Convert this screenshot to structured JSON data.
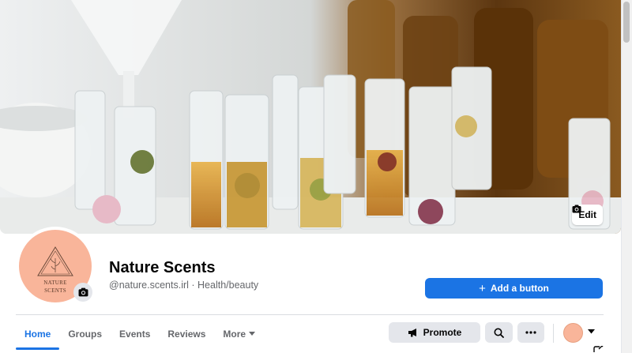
{
  "cover": {
    "edit_label": "Edit",
    "colors": {
      "bottle_amber": "#7a4a16",
      "glass": "#e8eef0",
      "oil": "#d89a35"
    }
  },
  "profile": {
    "logo_line1": "NATURE",
    "logo_line2": "SCENTS",
    "avatar_color": "#f9b59a",
    "name": "Nature Scents",
    "meta": "@nature.scents.irl · Health/beauty"
  },
  "actions": {
    "add_button_label": "Add a button",
    "promote_label": "Promote",
    "accent": "#1b74e4"
  },
  "tabs": [
    {
      "label": "Home",
      "active": true
    },
    {
      "label": "Groups"
    },
    {
      "label": "Events"
    },
    {
      "label": "Reviews"
    },
    {
      "label": "More"
    }
  ]
}
